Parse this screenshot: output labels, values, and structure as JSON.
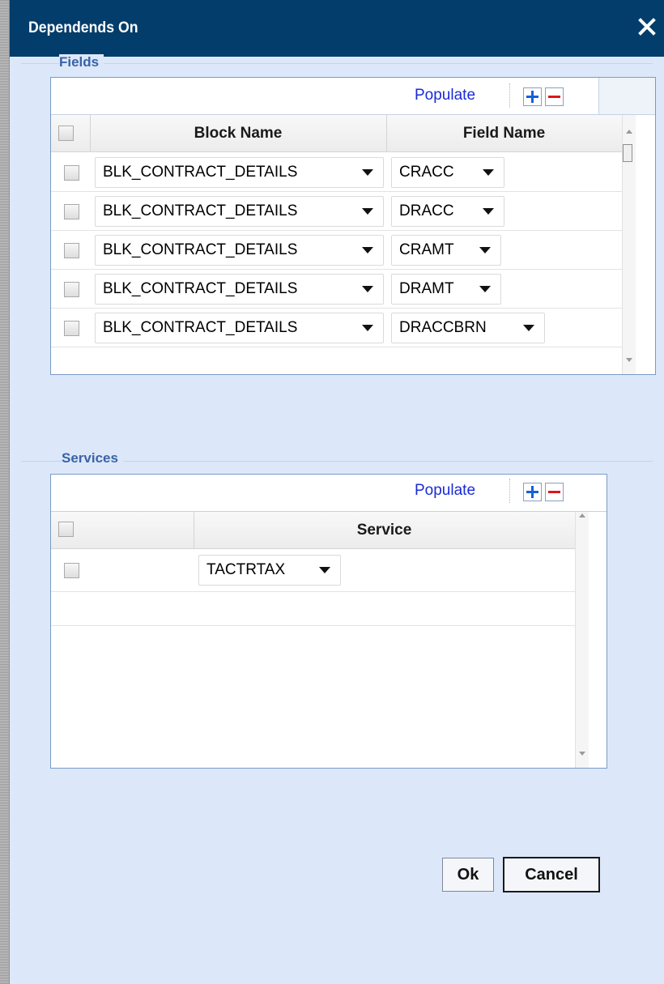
{
  "dialog": {
    "title": "Dependends On",
    "close_icon": "close-icon"
  },
  "fields": {
    "legend": "Fields",
    "populate_label": "Populate",
    "columns": [
      "Block Name",
      "Field Name"
    ],
    "rows": [
      {
        "block": "BLK_CONTRACT_DETAILS",
        "field": "CRACC",
        "checked": false
      },
      {
        "block": "BLK_CONTRACT_DETAILS",
        "field": "DRACC",
        "checked": false
      },
      {
        "block": "BLK_CONTRACT_DETAILS",
        "field": "CRAMT",
        "checked": false
      },
      {
        "block": "BLK_CONTRACT_DETAILS",
        "field": "DRAMT",
        "checked": false
      },
      {
        "block": "BLK_CONTRACT_DETAILS",
        "field": "DRACCBRN",
        "checked": false
      }
    ]
  },
  "services": {
    "legend": "Services",
    "populate_label": "Populate",
    "columns": [
      "Service"
    ],
    "rows": [
      {
        "service": "TACTRTAX",
        "checked": false
      }
    ]
  },
  "buttons": {
    "ok": "Ok",
    "cancel": "Cancel"
  },
  "colors": {
    "title_bar": "#033d6b",
    "dialog_bg": "#dce8f9",
    "legend": "#3a63a6",
    "populate_link": "#1a2bd6",
    "add_icon": "#1560d8",
    "remove_icon": "#e0161a"
  }
}
